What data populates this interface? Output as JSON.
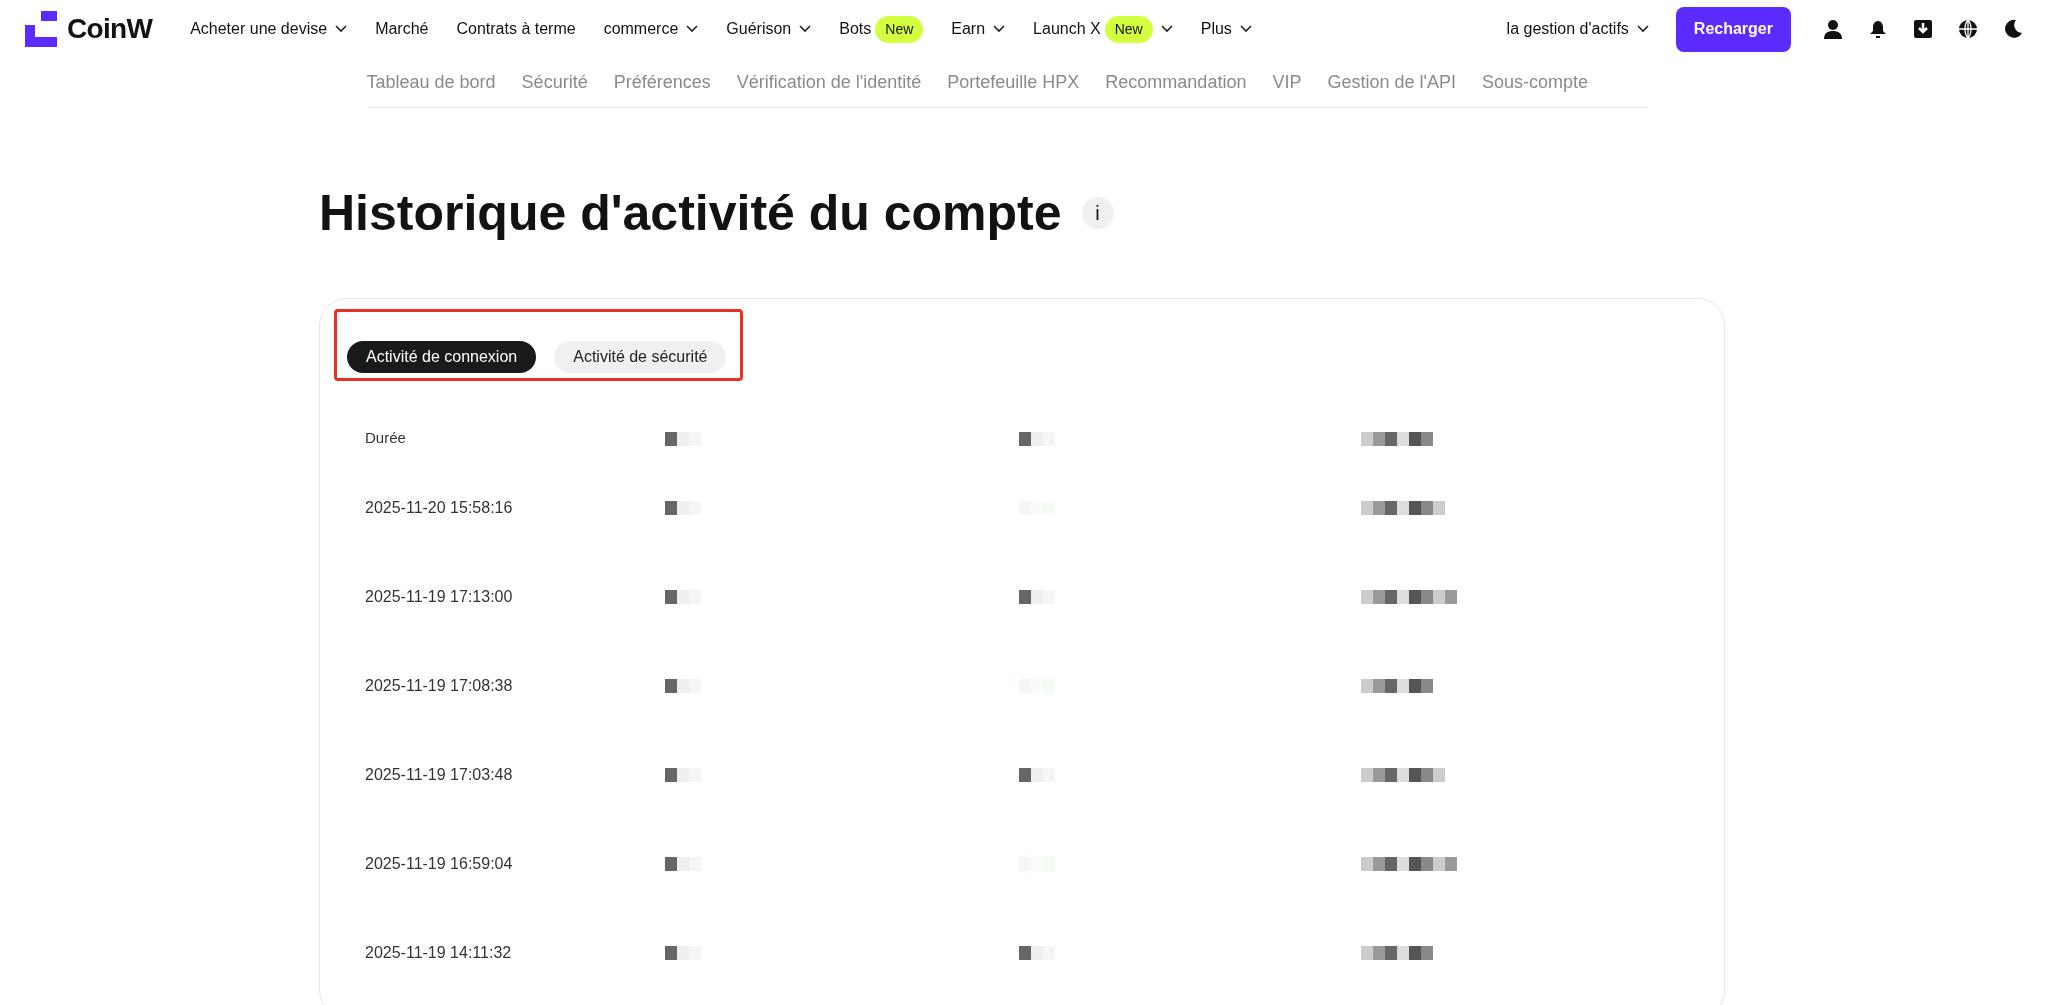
{
  "nav": {
    "logo": "CoinW",
    "items": [
      {
        "label": "Acheter une devise",
        "dropdown": true
      },
      {
        "label": "Marché",
        "dropdown": false
      },
      {
        "label": "Contrats à terme",
        "dropdown": false
      },
      {
        "label": "commerce",
        "dropdown": true
      },
      {
        "label": "Guérison",
        "dropdown": true
      },
      {
        "label": "Bots",
        "dropdown": false,
        "badge": "New"
      },
      {
        "label": "Earn",
        "dropdown": true
      },
      {
        "label": "Launch X",
        "dropdown": true,
        "badge": "New"
      },
      {
        "label": "Plus",
        "dropdown": true
      }
    ],
    "assets": "la gestion d'actifs",
    "deposit": "Recharger"
  },
  "subnav": [
    "Tableau de bord",
    "Sécurité",
    "Préférences",
    "Vérification de l'identité",
    "Portefeuille HPX",
    "Recommandation",
    "VIP",
    "Gestion de l'API",
    "Sous-compte"
  ],
  "title": "Historique d'activité du compte",
  "info": "i",
  "tabs": [
    {
      "label": "Activité de connexion",
      "selected": true
    },
    {
      "label": "Activité de sécurité",
      "selected": false
    }
  ],
  "table": {
    "columns": [
      "Durée"
    ],
    "rows": [
      {
        "time": "2025-11-20 15:58:16"
      },
      {
        "time": "2025-11-19 17:13:00"
      },
      {
        "time": "2025-11-19 17:08:38"
      },
      {
        "time": "2025-11-19 17:03:48"
      },
      {
        "time": "2025-11-19 16:59:04"
      },
      {
        "time": "2025-11-19 14:11:32"
      }
    ]
  }
}
